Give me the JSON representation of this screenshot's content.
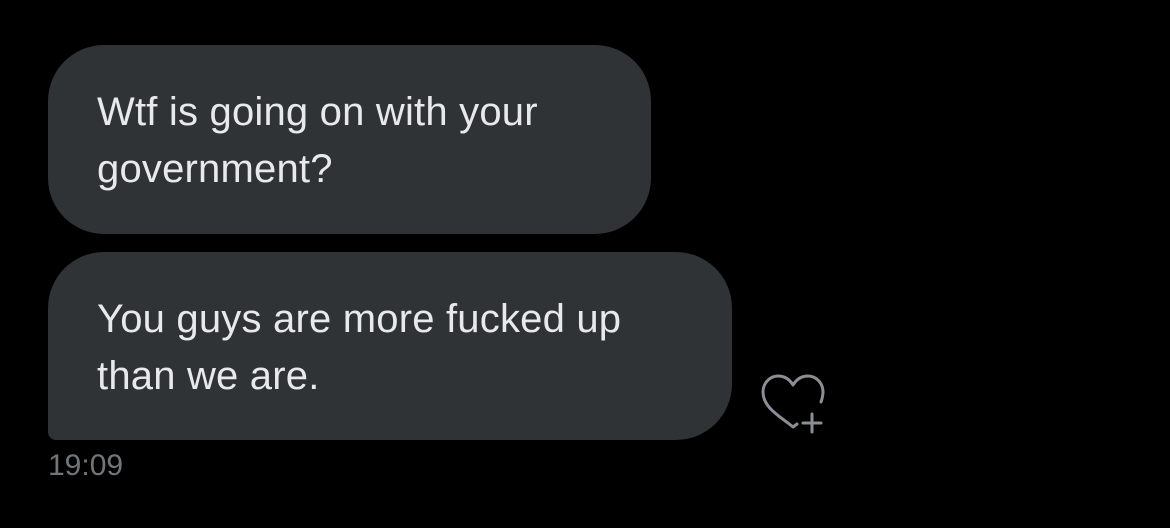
{
  "messages": [
    {
      "lines": [
        "Wtf is going on with your",
        "government?"
      ]
    },
    {
      "lines": [
        "You guys are more fucked up",
        "than we are."
      ]
    }
  ],
  "reaction": {
    "icon": "heart-plus-icon"
  },
  "timestamp": "19:09",
  "colors": {
    "background": "#000000",
    "bubble": "#2f3336",
    "message_text": "#e7e9ea",
    "meta_text": "#71767b"
  }
}
